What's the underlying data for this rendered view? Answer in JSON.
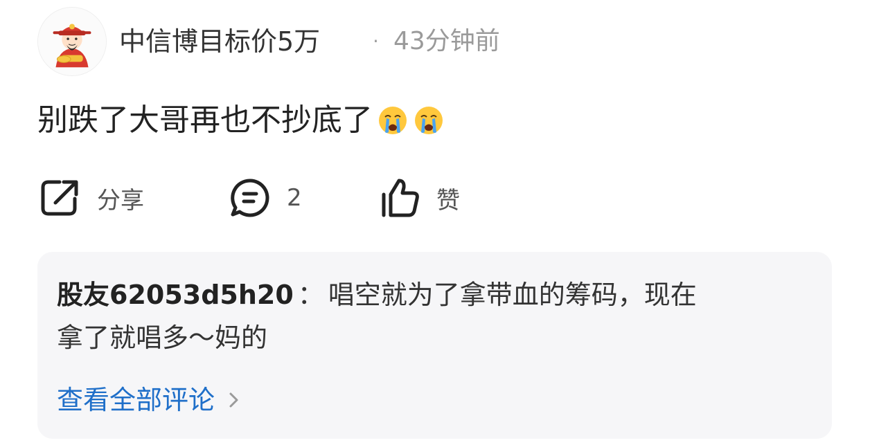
{
  "post": {
    "username": "中信博目标价5万",
    "separator": "·",
    "time": "43分钟前",
    "text": "别跌了大哥再也不抄底了",
    "emojis": [
      "crying-face",
      "crying-face"
    ]
  },
  "actions": {
    "share_label": "分享",
    "comment_count": "2",
    "like_label": "赞"
  },
  "comment_preview": {
    "author": "股友62053d5h20",
    "colon": "：",
    "text_line1": "唱空就为了拿带血的筹码，现在",
    "text_line2": "拿了就唱多～妈的",
    "view_all_label": "查看全部评论"
  },
  "colors": {
    "link_blue": "#1f6fc9",
    "card_bg": "#f6f6f8",
    "muted_text": "#9a9a9a"
  }
}
